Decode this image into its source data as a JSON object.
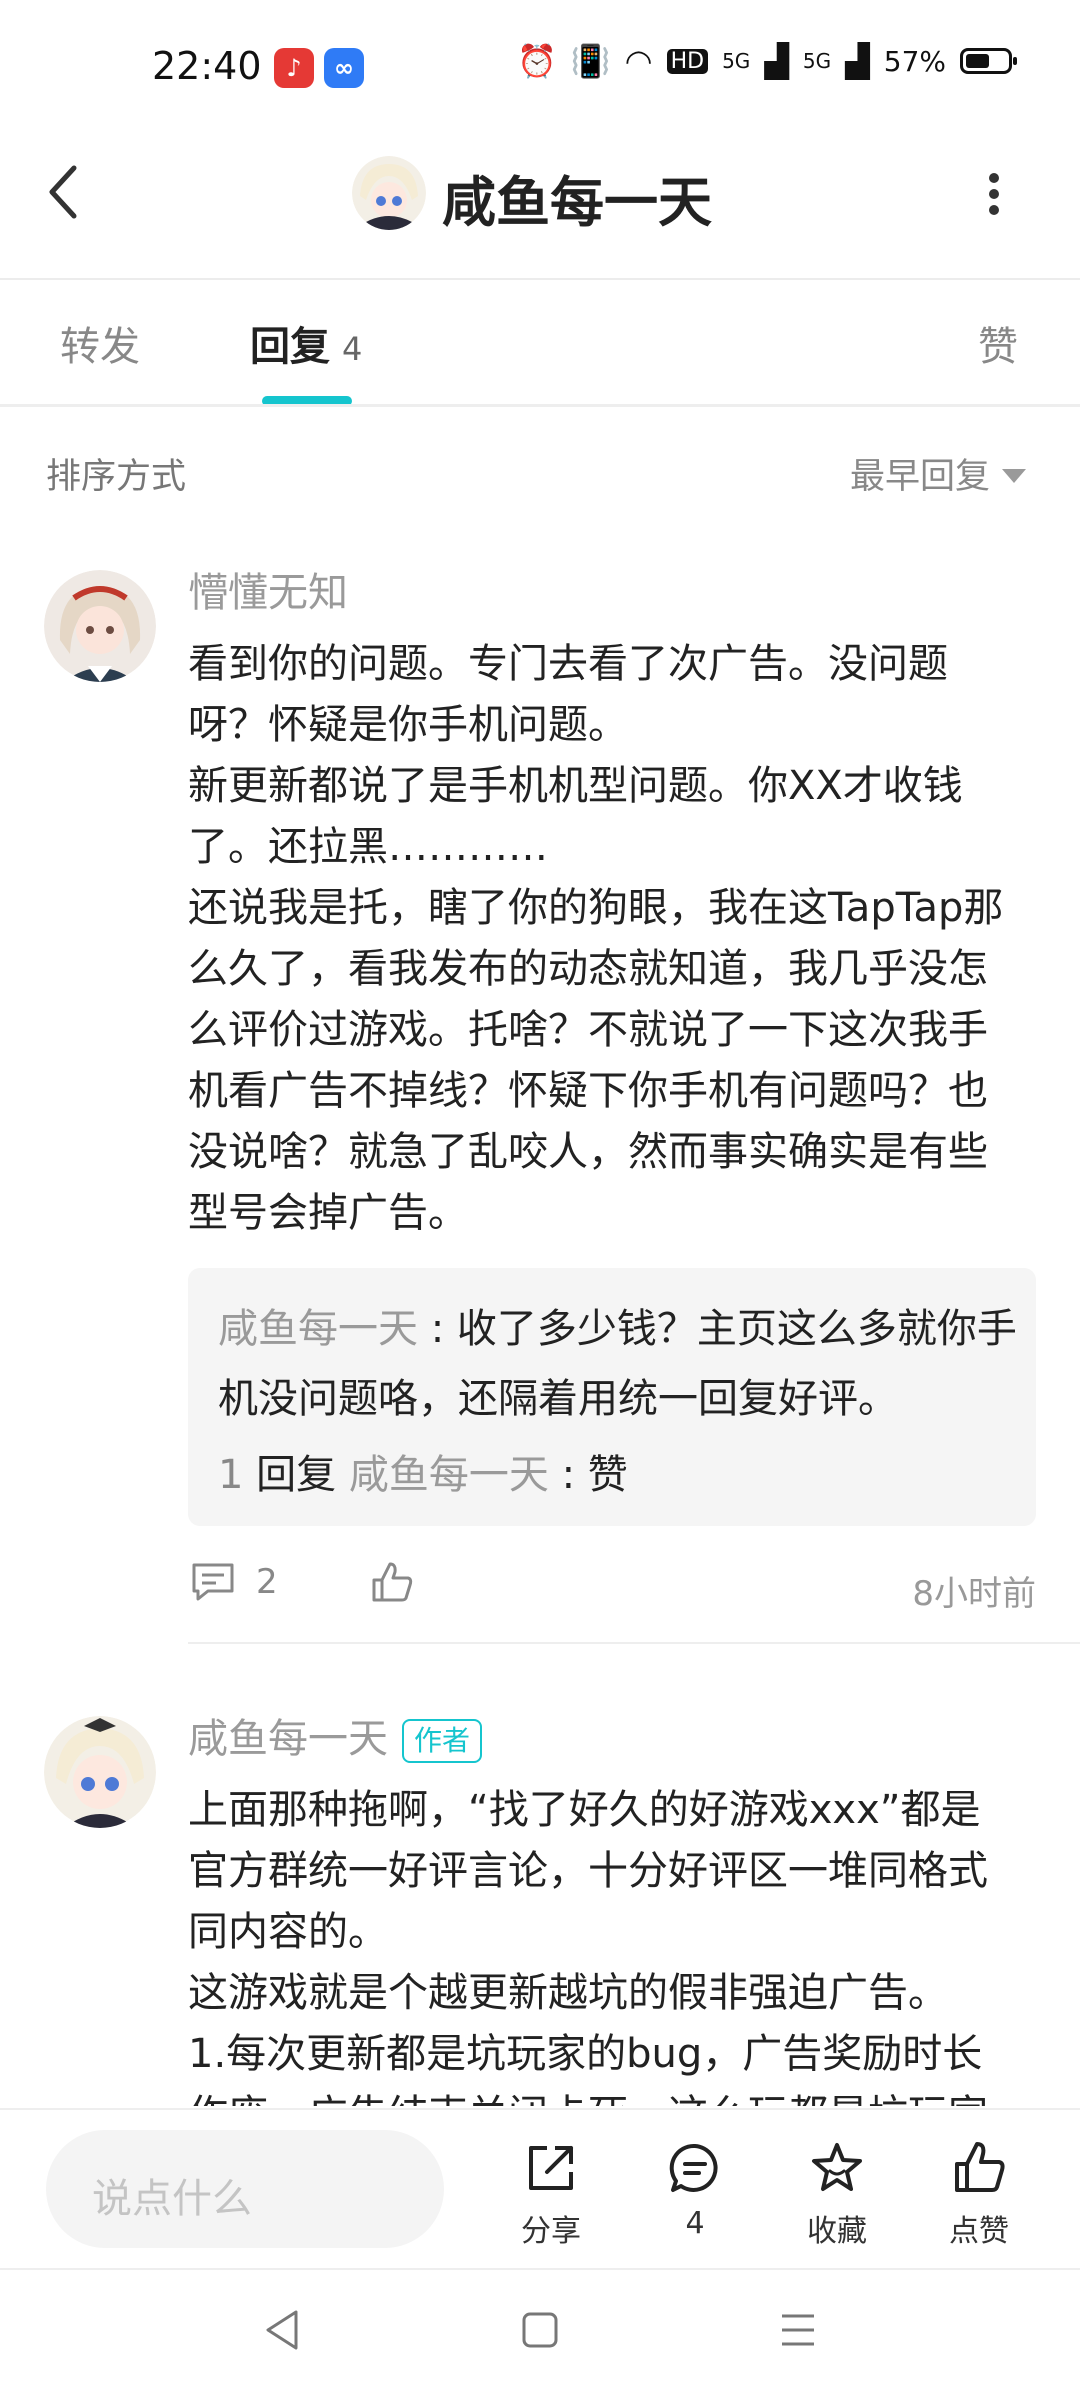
{
  "status_bar": {
    "time": "22:40",
    "battery_text": "57%",
    "battery_level": 0.57,
    "net_label_1": "5G",
    "net_label_2": "5G",
    "hd_label": "HD"
  },
  "header": {
    "title": "咸鱼每一天"
  },
  "tabs": {
    "forward": "转发",
    "reply": "回复",
    "reply_count": "4",
    "like": "赞"
  },
  "sort": {
    "label": "排序方式",
    "value": "最早回复"
  },
  "comments": [
    {
      "user": "懵懂无知",
      "text": "看到你的问题。专门去看了次广告。没问题呀？怀疑是你手机问题。\n新更新都说了是手机机型问题。你XX才收钱了。还拉黑…………\n还说我是托，瞎了你的狗眼，我在这TapTap那么久了，看我发布的动态就知道，我几乎没怎么评价过游戏。托啥？不就说了一下这次我手机看广告不掉线？怀疑下你手机有问题吗？也没说啥？就急了乱咬人，然而事实确实是有些型号会掉广告。",
      "quote": {
        "name": "咸鱼每一天",
        "sep": " : ",
        "text": "收了多少钱？主页这么多就你手机没问题咯，还隔着用统一回复好评。",
        "reply_count": "1",
        "reply_label": "回复",
        "reply_name": "咸鱼每一天",
        "reply_text": "赞"
      },
      "comment_count": "2",
      "time": "8小时前"
    },
    {
      "user": "咸鱼每一天",
      "badge": "作者",
      "text": "上面那种拖啊，“找了好久的好游戏xxx”都是官方群统一好评言论，十分好评区一堆同格式同内容的。\n这游戏就是个越更新越坑的假非强迫广告。\n1.每次更新都是坑玩家的bug，广告奖励时长作废，广告结束关闭卡死，这么玩都是坑玩家"
    }
  ],
  "bottom_bar": {
    "input_placeholder": "说点什么",
    "share_label": "分享",
    "comment_count": "4",
    "collect_label": "收藏",
    "like_label": "点赞"
  },
  "colors": {
    "accent": "#15c5ce",
    "muted": "#9a9a9a"
  }
}
